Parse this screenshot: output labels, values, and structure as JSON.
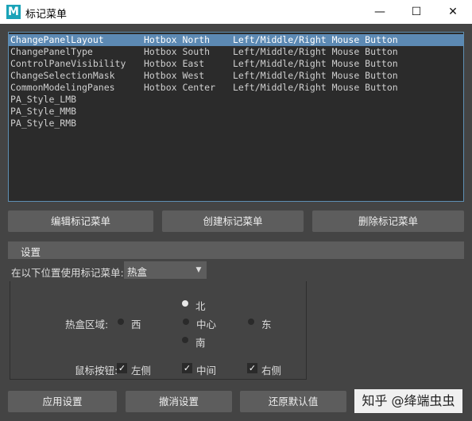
{
  "window": {
    "title": "标记菜单",
    "app_icon_letter": "M",
    "min_glyph": "—",
    "max_glyph": "☐",
    "close_glyph": "✕"
  },
  "list": {
    "rows": [
      {
        "name": "ChangePanelLayout",
        "location": "Hotbox North",
        "button": "Left/Middle/Right Mouse Button",
        "selected": true
      },
      {
        "name": "ChangePanelType",
        "location": "Hotbox South",
        "button": "Left/Middle/Right Mouse Button"
      },
      {
        "name": "ControlPaneVisibility",
        "location": "Hotbox East",
        "button": "Left/Middle/Right Mouse Button"
      },
      {
        "name": "ChangeSelectionMask",
        "location": "Hotbox West",
        "button": "Left/Middle/Right Mouse Button"
      },
      {
        "name": "CommonModelingPanes",
        "location": "Hotbox Center",
        "button": "Left/Middle/Right Mouse Button"
      },
      {
        "name": "PA_Style_LMB",
        "location": "",
        "button": ""
      },
      {
        "name": "PA_Style_MMB",
        "location": "",
        "button": ""
      },
      {
        "name": "PA_Style_RMB",
        "location": "",
        "button": ""
      }
    ]
  },
  "actions": {
    "edit": "编辑标记菜单",
    "create": "创建标记菜单",
    "delete": "删除标记菜单"
  },
  "settings": {
    "title": "设置",
    "use_in_label": "在以下位置使用标记菜单:",
    "use_in_value": "热盒",
    "region_label": "热盒区域:",
    "regions": {
      "north": "北",
      "west": "西",
      "center": "中心",
      "east": "东",
      "south": "南"
    },
    "selected_region": "north",
    "mouse_label": "鼠标按钮:",
    "mouse": {
      "left": "左侧",
      "middle": "中间",
      "right": "右侧"
    },
    "check_glyph": "✓"
  },
  "footer": {
    "apply": "应用设置",
    "cancel": "撤消设置",
    "restore": "还原默认值"
  },
  "watermark": "知乎 @绛端虫虫"
}
